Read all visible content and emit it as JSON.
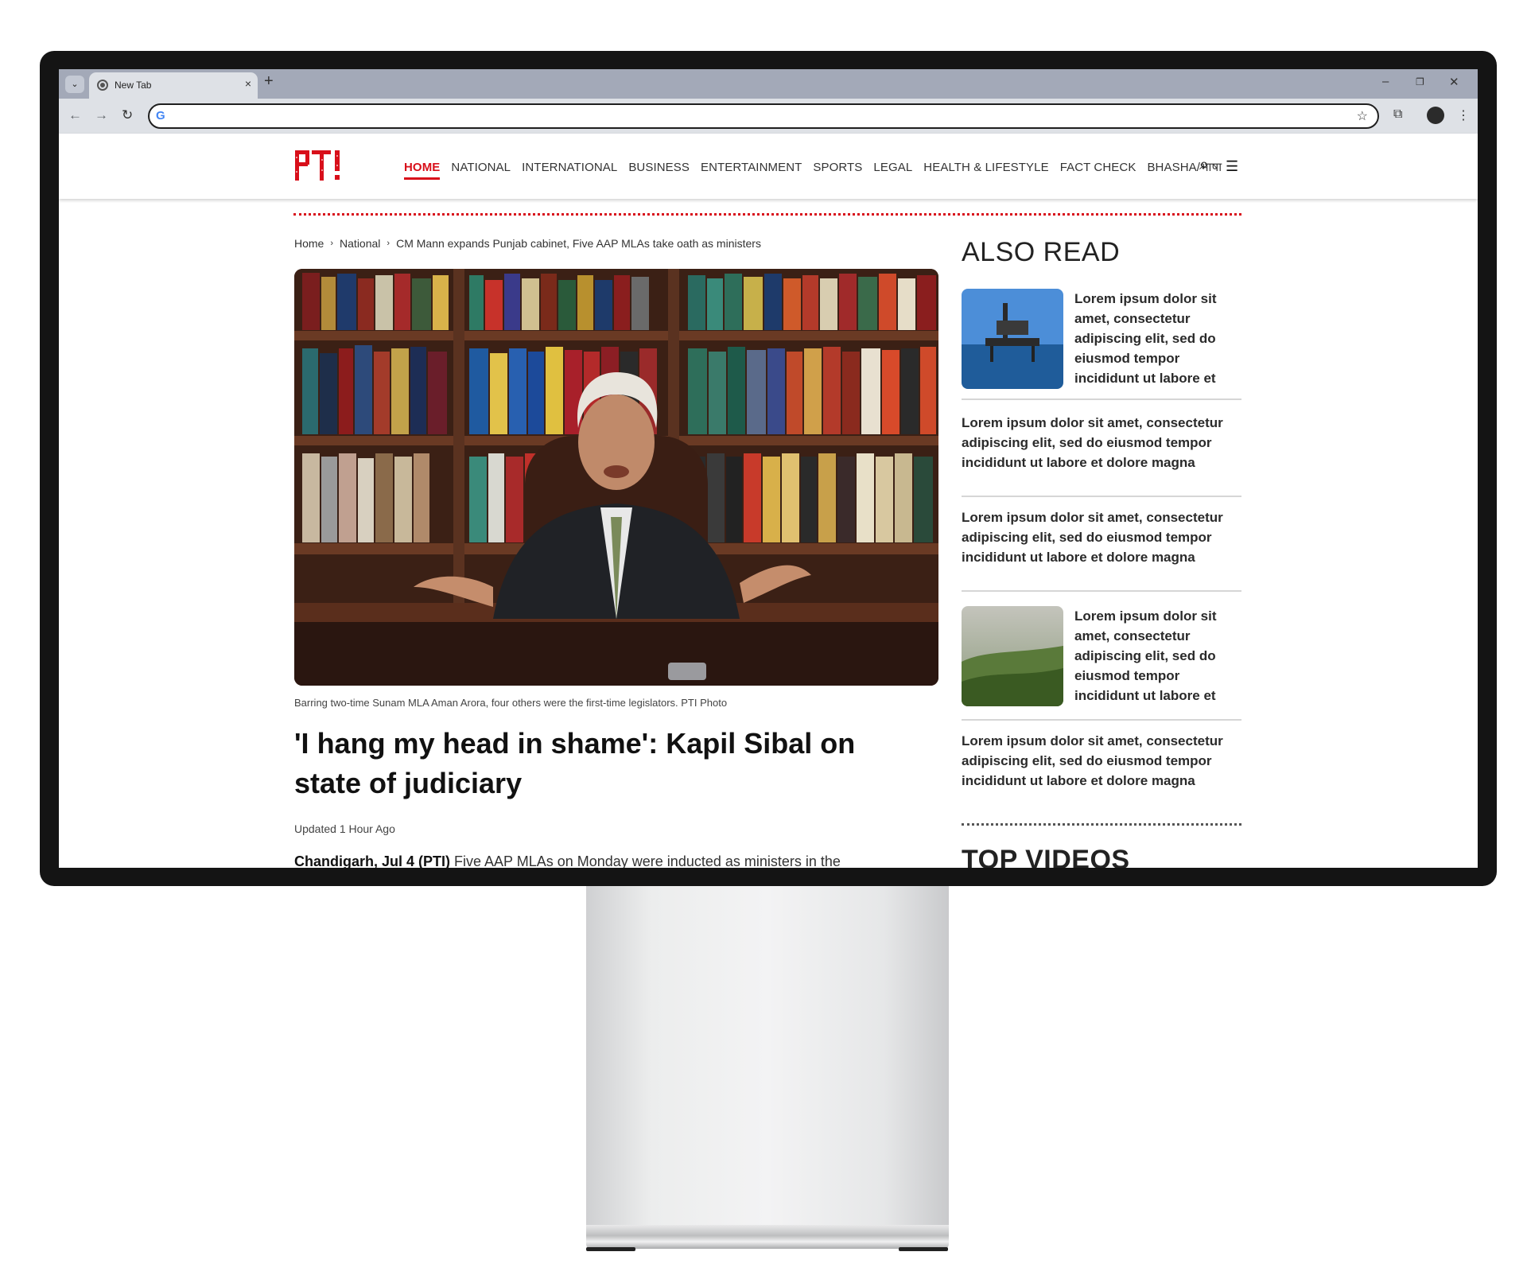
{
  "browser": {
    "tab_title": "New Tab",
    "tab_close": "×",
    "new_tab": "+",
    "tab_list": "⌄",
    "window": {
      "minimize": "–",
      "restore": "❐",
      "close": "✕"
    },
    "nav": {
      "back": "←",
      "forward": "→",
      "reload": "↻"
    },
    "omnibox_g": "G",
    "bookmark": "☆",
    "extensions": "⧉",
    "menu": "⋮"
  },
  "site": {
    "logo_text": "PTI",
    "nav_items": [
      "HOME",
      "NATIONAL",
      "INTERNATIONAL",
      "BUSINESS",
      "ENTERTAINMENT",
      "SPORTS",
      "LEGAL",
      "HEALTH & LIFESTYLE",
      "FACT CHECK",
      "BHASHA/भाषा"
    ],
    "search_icon": "⌕",
    "menu_icon": "☰",
    "accent_color": "#d80f1a"
  },
  "breadcrumb": {
    "items": [
      "Home",
      "National",
      "CM Mann expands Punjab cabinet, Five AAP MLAs take oath as ministers"
    ],
    "separator": "›"
  },
  "article": {
    "caption": "Barring two-time Sunam MLA Aman Arora, four others were the first-time legislators. PTI Photo",
    "headline": "'I hang my head in shame': Kapil Sibal on state of judiciary",
    "updated": "Updated 1 Hour Ago",
    "dateline": "Chandigarh, Jul 4 (PTI)",
    "lede": " Five AAP MLAs on Monday were inducted as ministers in the"
  },
  "sidebar": {
    "also_read_title": "ALSO READ",
    "items": [
      {
        "text": "Lorem ipsum dolor sit amet, consectetur adipiscing elit, sed do eiusmod tempor incididunt ut labore et",
        "thumb": "oil-rig-photo"
      },
      {
        "text": "Lorem ipsum dolor sit amet, consectetur adipiscing elit, sed do eiusmod tempor incididunt ut labore et dolore magna"
      },
      {
        "text": "Lorem ipsum dolor sit amet, consectetur adipiscing elit, sed do eiusmod tempor incididunt ut labore et dolore magna"
      },
      {
        "text": "Lorem ipsum dolor sit amet, consectetur adipiscing elit, sed do eiusmod tempor incididunt ut labore et",
        "thumb": "misty-hills-photo"
      },
      {
        "text": "Lorem ipsum dolor sit amet, consectetur adipiscing elit, sed do eiusmod tempor incididunt ut labore et dolore magna"
      }
    ],
    "top_videos_title": "TOP VIDEOS"
  }
}
